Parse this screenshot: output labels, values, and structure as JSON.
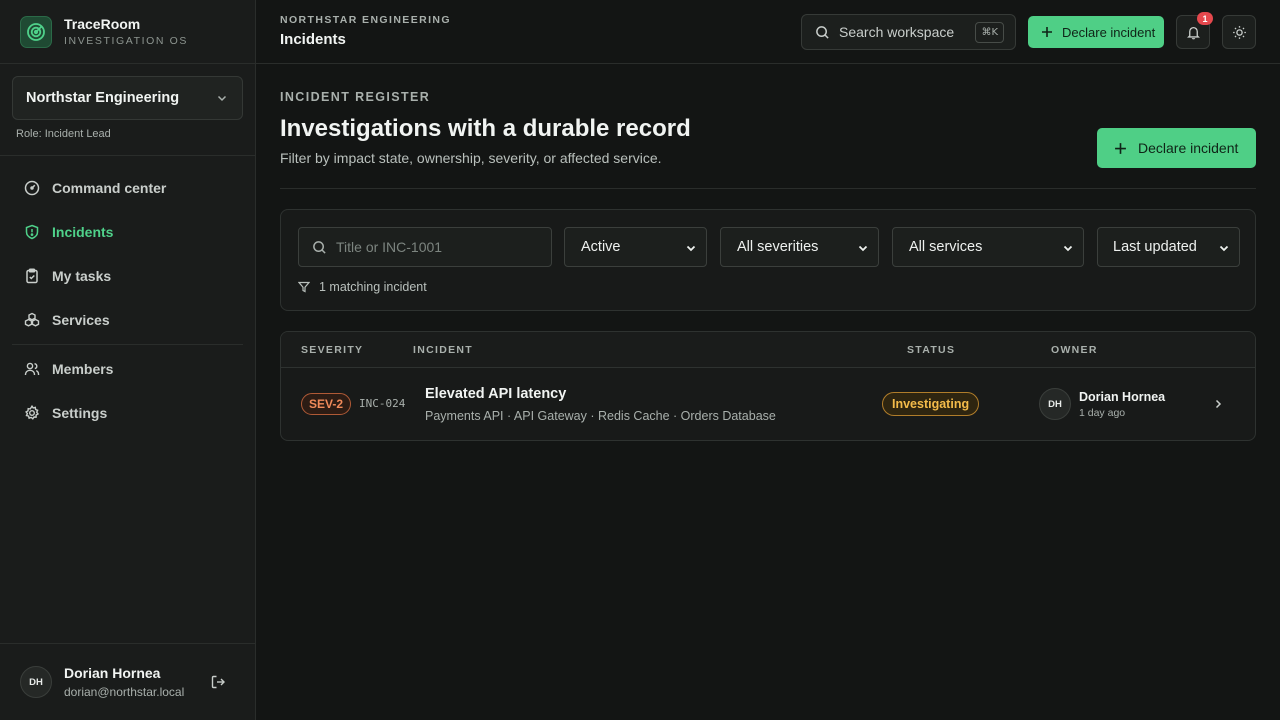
{
  "brand": {
    "name": "TraceRoom",
    "subtitle": "INVESTIGATION OS"
  },
  "workspace": {
    "name": "Northstar Engineering",
    "role": "Role: Incident Lead"
  },
  "nav": {
    "items": [
      {
        "id": "command-center",
        "label": "Command center",
        "icon": "gauge-icon",
        "active": false
      },
      {
        "id": "incidents",
        "label": "Incidents",
        "icon": "shield-icon",
        "active": true
      },
      {
        "id": "my-tasks",
        "label": "My tasks",
        "icon": "clipboard-icon",
        "active": false
      },
      {
        "id": "services",
        "label": "Services",
        "icon": "boxes-icon",
        "active": false
      }
    ],
    "secondary": [
      {
        "id": "members",
        "label": "Members",
        "icon": "users-icon"
      },
      {
        "id": "settings",
        "label": "Settings",
        "icon": "gear-icon"
      }
    ]
  },
  "user": {
    "initials": "DH",
    "name": "Dorian Hornea",
    "email": "dorian@northstar.local"
  },
  "topbar": {
    "org": "NORTHSTAR ENGINEERING",
    "title": "Incidents",
    "search_label": "Search workspace",
    "search_shortcut": "⌘K",
    "declare_label": "Declare incident",
    "notification_count": "1"
  },
  "main": {
    "eyebrow": "INCIDENT REGISTER",
    "title": "Investigations with a durable record",
    "subtitle": "Filter by impact state, ownership, severity, or affected service.",
    "declare_label": "Declare incident"
  },
  "filters": {
    "search_placeholder": "Title or INC-1001",
    "state": "Active",
    "severity": "All severities",
    "service": "All services",
    "sort": "Last updated",
    "match_text": "1 matching incident"
  },
  "table": {
    "headers": {
      "severity": "SEVERITY",
      "incident": "INCIDENT",
      "status": "STATUS",
      "owner": "OWNER"
    },
    "rows": [
      {
        "severity": "SEV-2",
        "id": "INC-024",
        "title": "Elevated API latency",
        "services": "Payments API · API Gateway · Redis Cache · Orders Database",
        "status": "Investigating",
        "owner_initials": "DH",
        "owner_name": "Dorian Hornea",
        "updated": "1 day ago"
      }
    ]
  },
  "colors": {
    "accent": "#4fcf86",
    "background": "#131514",
    "sidebar": "#1a1c1b",
    "sev2": "#f08a5a",
    "investigating": "#f3bb4a",
    "danger": "#e5484d"
  }
}
